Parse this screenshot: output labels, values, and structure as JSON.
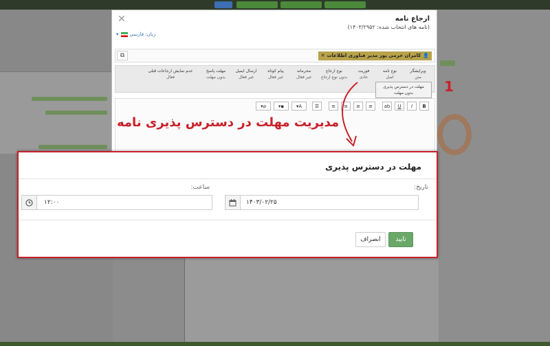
{
  "modal": {
    "title": "ارجاع نامه",
    "subtitle": "(نامه های انتخاب شده: ۱۴۰۳/۲۹۵۲)",
    "language_label": "زبان: فارسی",
    "recipient_tag": "کامران خرمی پور مدیر فناوری اطلاعات",
    "options": [
      {
        "label": "ویرایشگر",
        "value": "متن"
      },
      {
        "label": "نوع نامه",
        "value": "اصل"
      },
      {
        "label": "فوریت",
        "value": "عادی"
      },
      {
        "label": "نوع ارجاع",
        "value": "بدون نوع ارجاع"
      },
      {
        "label": "محرمانه",
        "value": "غیر فعال"
      },
      {
        "label": "پیام کوتاه",
        "value": "غیر فعال"
      },
      {
        "label": "ارسال ایمیل",
        "value": "غیر فعال"
      },
      {
        "label": "مهلت پاسخ",
        "value": "بدون مهلت"
      },
      {
        "label": "عدم نمایش ارجاعات قبلی",
        "value": "فعال"
      }
    ],
    "deadline_option": {
      "label": "مهلت در دسترس پذیری",
      "value": "بدون مهلت"
    }
  },
  "annotation": {
    "text": "مدیریت مهلت در دسترس پذیری نامه",
    "marker": "1"
  },
  "dialog": {
    "title": "مهلت در دسترس پذیری",
    "date_label": "تاریخ:",
    "date_value": "۱۴۰۳/۰۲/۲۵",
    "time_label": "ساعت:",
    "time_value": "۱۲:۰۰",
    "confirm_label": "تایید",
    "cancel_label": "انصراف"
  },
  "colors": {
    "annotation": "#c8202a",
    "confirm": "#6aa86a",
    "tag": "#b8a24a"
  }
}
